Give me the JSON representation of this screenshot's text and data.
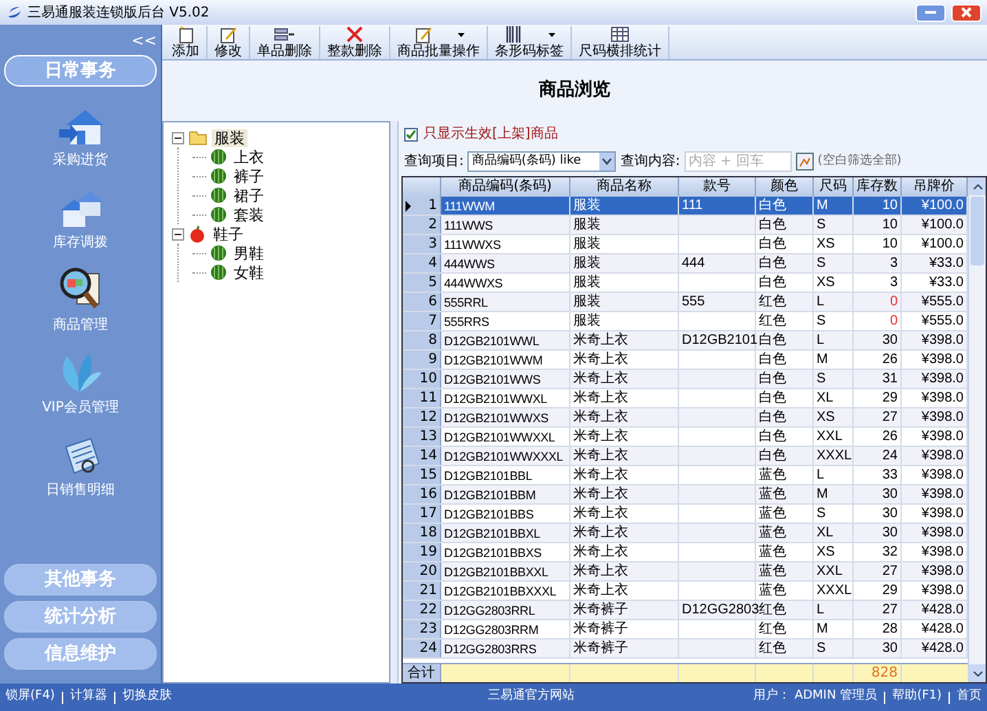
{
  "window": {
    "title": "三易通服装连锁版后台 V5.02"
  },
  "sidebar": {
    "collapse": "<<",
    "sections": [
      {
        "label": "日常事务",
        "expanded": true,
        "items": [
          {
            "label": "采购进货"
          },
          {
            "label": "库存调拨"
          },
          {
            "label": "商品管理"
          },
          {
            "label": "VIP会员管理"
          },
          {
            "label": "日销售明细"
          }
        ]
      },
      {
        "label": "其他事务",
        "expanded": false
      },
      {
        "label": "统计分析",
        "expanded": false
      },
      {
        "label": "信息维护",
        "expanded": false
      }
    ]
  },
  "toolbar": [
    {
      "label": "添加",
      "has_menu": false
    },
    {
      "label": "修改",
      "has_menu": false
    },
    {
      "label": "单品删除",
      "has_menu": false
    },
    {
      "label": "整款删除",
      "has_menu": false
    },
    {
      "label": "商品批量操作",
      "has_menu": true
    },
    {
      "label": "条形码标签",
      "has_menu": true
    },
    {
      "label": "尺码横排统计",
      "has_menu": false
    }
  ],
  "page_title": "商品浏览",
  "tree": [
    {
      "label": "服装",
      "kind": "folder",
      "expanded": true,
      "selected": true,
      "children": [
        {
          "label": "上衣",
          "kind": "leaf",
          "selected": false
        },
        {
          "label": "裤子",
          "kind": "leaf",
          "selected": false
        },
        {
          "label": "裙子",
          "kind": "leaf",
          "selected": false
        },
        {
          "label": "套装",
          "kind": "leaf",
          "selected": false
        }
      ]
    },
    {
      "label": "鞋子",
      "kind": "fruit",
      "expanded": true,
      "selected": false,
      "children": [
        {
          "label": "男鞋",
          "kind": "leaf",
          "selected": false
        },
        {
          "label": "女鞋",
          "kind": "leaf",
          "selected": false
        }
      ]
    }
  ],
  "filter": {
    "label": "只显示生效[上架]商品",
    "checked": true
  },
  "query": {
    "field_label": "查询项目:",
    "field_value": "商品编码(条码) like",
    "content_label": "查询内容:",
    "placeholder": "内容 + 回车",
    "hint": "(空白筛选全部)"
  },
  "table": {
    "columns": [
      "商品编码(条码)",
      "商品名称",
      "款号",
      "颜色",
      "尺码",
      "库存数",
      "吊牌价"
    ],
    "rows": [
      {
        "no": "1",
        "cells": [
          "111WWM",
          "服装",
          "111",
          "白色",
          "M",
          "10",
          "¥100.0"
        ],
        "selected": true,
        "stock_warning": false
      },
      {
        "no": "2",
        "cells": [
          "111WWS",
          "服装",
          "",
          "白色",
          "S",
          "10",
          "¥100.0"
        ],
        "selected": false,
        "stock_warning": false
      },
      {
        "no": "3",
        "cells": [
          "111WWXS",
          "服装",
          "",
          "白色",
          "XS",
          "10",
          "¥100.0"
        ],
        "selected": false,
        "stock_warning": false
      },
      {
        "no": "4",
        "cells": [
          "444WWS",
          "服装",
          "444",
          "白色",
          "S",
          "3",
          "¥33.0"
        ],
        "selected": false,
        "stock_warning": false
      },
      {
        "no": "5",
        "cells": [
          "444WWXS",
          "服装",
          "",
          "白色",
          "XS",
          "3",
          "¥33.0"
        ],
        "selected": false,
        "stock_warning": false
      },
      {
        "no": "6",
        "cells": [
          "555RRL",
          "服装",
          "555",
          "红色",
          "L",
          "0",
          "¥555.0"
        ],
        "selected": false,
        "stock_warning": true
      },
      {
        "no": "7",
        "cells": [
          "555RRS",
          "服装",
          "",
          "红色",
          "S",
          "0",
          "¥555.0"
        ],
        "selected": false,
        "stock_warning": true
      },
      {
        "no": "8",
        "cells": [
          "D12GB2101WWL",
          "米奇上衣",
          "D12GB2101",
          "白色",
          "L",
          "30",
          "¥398.0"
        ],
        "selected": false,
        "stock_warning": false
      },
      {
        "no": "9",
        "cells": [
          "D12GB2101WWM",
          "米奇上衣",
          "",
          "白色",
          "M",
          "26",
          "¥398.0"
        ],
        "selected": false,
        "stock_warning": false
      },
      {
        "no": "10",
        "cells": [
          "D12GB2101WWS",
          "米奇上衣",
          "",
          "白色",
          "S",
          "31",
          "¥398.0"
        ],
        "selected": false,
        "stock_warning": false
      },
      {
        "no": "11",
        "cells": [
          "D12GB2101WWXL",
          "米奇上衣",
          "",
          "白色",
          "XL",
          "29",
          "¥398.0"
        ],
        "selected": false,
        "stock_warning": false
      },
      {
        "no": "12",
        "cells": [
          "D12GB2101WWXS",
          "米奇上衣",
          "",
          "白色",
          "XS",
          "27",
          "¥398.0"
        ],
        "selected": false,
        "stock_warning": false
      },
      {
        "no": "13",
        "cells": [
          "D12GB2101WWXXL",
          "米奇上衣",
          "",
          "白色",
          "XXL",
          "26",
          "¥398.0"
        ],
        "selected": false,
        "stock_warning": false
      },
      {
        "no": "14",
        "cells": [
          "D12GB2101WWXXXL",
          "米奇上衣",
          "",
          "白色",
          "XXXL",
          "24",
          "¥398.0"
        ],
        "selected": false,
        "stock_warning": false
      },
      {
        "no": "15",
        "cells": [
          "D12GB2101BBL",
          "米奇上衣",
          "",
          "蓝色",
          "L",
          "33",
          "¥398.0"
        ],
        "selected": false,
        "stock_warning": false
      },
      {
        "no": "16",
        "cells": [
          "D12GB2101BBM",
          "米奇上衣",
          "",
          "蓝色",
          "M",
          "30",
          "¥398.0"
        ],
        "selected": false,
        "stock_warning": false
      },
      {
        "no": "17",
        "cells": [
          "D12GB2101BBS",
          "米奇上衣",
          "",
          "蓝色",
          "S",
          "30",
          "¥398.0"
        ],
        "selected": false,
        "stock_warning": false
      },
      {
        "no": "18",
        "cells": [
          "D12GB2101BBXL",
          "米奇上衣",
          "",
          "蓝色",
          "XL",
          "30",
          "¥398.0"
        ],
        "selected": false,
        "stock_warning": false
      },
      {
        "no": "19",
        "cells": [
          "D12GB2101BBXS",
          "米奇上衣",
          "",
          "蓝色",
          "XS",
          "32",
          "¥398.0"
        ],
        "selected": false,
        "stock_warning": false
      },
      {
        "no": "20",
        "cells": [
          "D12GB2101BBXXL",
          "米奇上衣",
          "",
          "蓝色",
          "XXL",
          "27",
          "¥398.0"
        ],
        "selected": false,
        "stock_warning": false
      },
      {
        "no": "21",
        "cells": [
          "D12GB2101BBXXXL",
          "米奇上衣",
          "",
          "蓝色",
          "XXXL",
          "29",
          "¥398.0"
        ],
        "selected": false,
        "stock_warning": false
      },
      {
        "no": "22",
        "cells": [
          "D12GG2803RRL",
          "米奇裤子",
          "D12GG2803",
          "红色",
          "L",
          "27",
          "¥428.0"
        ],
        "selected": false,
        "stock_warning": false
      },
      {
        "no": "23",
        "cells": [
          "D12GG2803RRM",
          "米奇裤子",
          "",
          "红色",
          "M",
          "28",
          "¥428.0"
        ],
        "selected": false,
        "stock_warning": false
      },
      {
        "no": "24",
        "cells": [
          "D12GG2803RRS",
          "米奇裤子",
          "",
          "红色",
          "S",
          "30",
          "¥428.0"
        ],
        "selected": false,
        "stock_warning": false
      }
    ],
    "footer": {
      "label": "合计",
      "stock_total": "828"
    }
  },
  "status_bar": {
    "left": [
      "锁屏(F4)",
      "计算器",
      "切换皮肤"
    ],
    "center": "三易通官方网站",
    "user_label": "用户：",
    "user": "ADMIN 管理员",
    "right": [
      "帮助(F1)",
      "首页"
    ]
  }
}
